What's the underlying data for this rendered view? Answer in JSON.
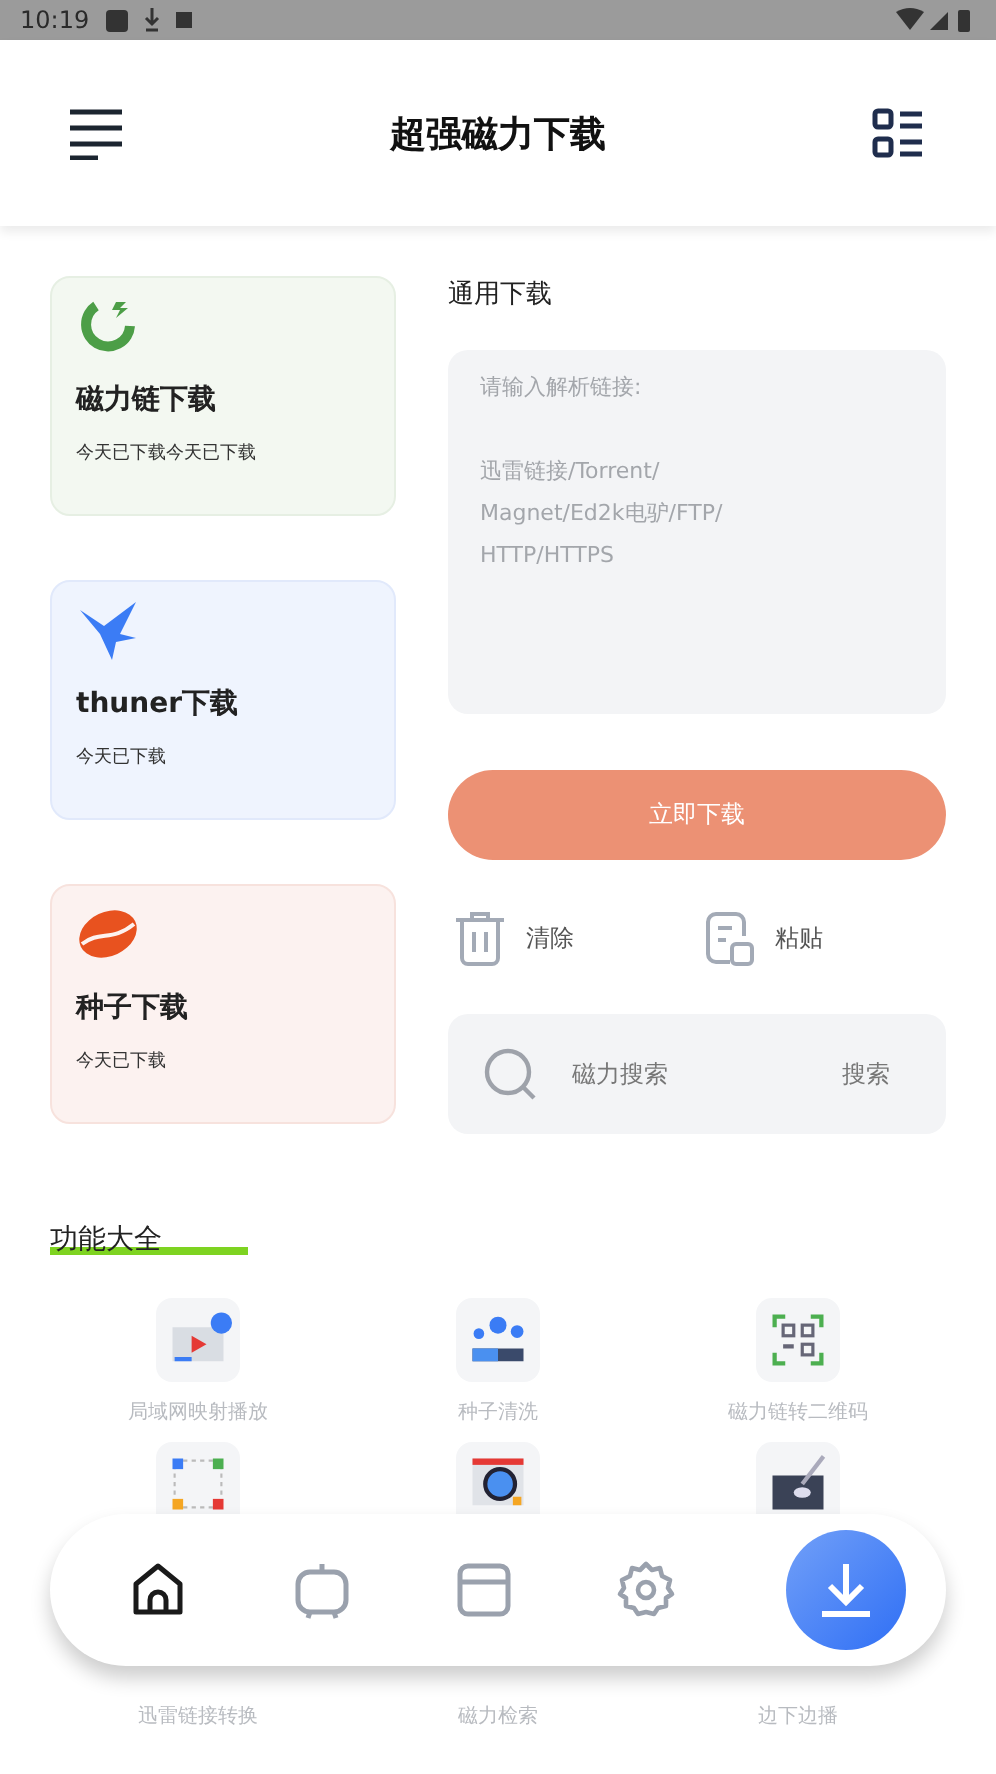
{
  "status_bar": {
    "time": "10:19"
  },
  "header": {
    "title": "超强磁力下载"
  },
  "cards": [
    {
      "kind": "magnet",
      "title": "磁力链下载",
      "subtitle": "今天已下载今天已下载"
    },
    {
      "kind": "bird",
      "title": "thuner下载",
      "subtitle": "今天已下载"
    },
    {
      "kind": "seed",
      "title": "种子下载",
      "subtitle": "今天已下载"
    }
  ],
  "general_download": {
    "title": "通用下载",
    "placeholder": "请输入解析链接:\n\n迅雷链接/Torrent/\nMagnet/Ed2k电驴/FTP/\nHTTP/HTTPS",
    "button": "立即下载"
  },
  "actions": [
    {
      "kind": "clear",
      "label": "清除"
    },
    {
      "kind": "paste",
      "label": "粘贴"
    }
  ],
  "search": {
    "placeholder": "磁力搜索",
    "button": "搜索"
  },
  "features": {
    "title": "功能大全",
    "items": [
      {
        "kind": "cast",
        "label": "局域网映射播放"
      },
      {
        "kind": "gears",
        "label": "种子清洗"
      },
      {
        "kind": "qr",
        "label": "磁力链转二维码"
      },
      {
        "kind": "scan",
        "label": "迅雷链接转换"
      },
      {
        "kind": "lens",
        "label": "磁力检索"
      },
      {
        "kind": "play",
        "label": "边下边播"
      }
    ]
  },
  "nav": [
    {
      "kind": "home",
      "selected": true
    },
    {
      "kind": "tv",
      "selected": false
    },
    {
      "kind": "card",
      "selected": false
    },
    {
      "kind": "settings",
      "selected": false
    },
    {
      "kind": "download",
      "selected": false
    }
  ]
}
